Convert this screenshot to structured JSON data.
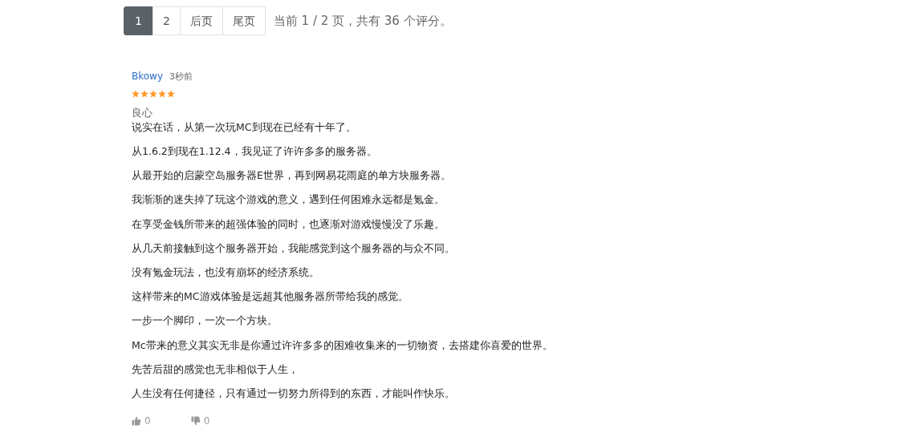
{
  "pagination": {
    "pages": [
      {
        "label": "1",
        "selected": true
      },
      {
        "label": "2",
        "selected": false
      },
      {
        "label": "后页",
        "selected": false
      },
      {
        "label": "尾页",
        "selected": false
      }
    ],
    "summary": "当前 1 / 2 页，共有 36 个评分。"
  },
  "review": {
    "author": "Bkowy",
    "time": "3秒前",
    "stars": 5,
    "title": "良心",
    "lines": [
      "说实在话，从第一次玩MC到现在已经有十年了。",
      "从1.6.2到现在1.12.4，我见证了许许多多的服务器。",
      "从最开始的启蒙空岛服务器E世界，再到网易花雨庭的单方块服务器。",
      "我渐渐的迷失掉了玩这个游戏的意义，遇到任何困难永远都是氪金。",
      "在享受金钱所带来的超强体验的同时，也逐渐对游戏慢慢没了乐趣。",
      "从几天前接触到这个服务器开始，我能感觉到这个服务器的与众不同。",
      "没有氪金玩法，也没有崩坏的经济系统。",
      "这样带来的MC游戏体验是远超其他服务器所带给我的感觉。",
      "一步一个脚印，一次一个方块。",
      "Mc带来的意义其实无非是你通过许许多多的困难收集来的一切物资，去搭建你喜爱的世界。",
      "先苦后甜的感觉也无非相似于人生，",
      "人生没有任何捷径，只有通过一切努力所得到的东西，才能叫作快乐。"
    ],
    "likes": "0",
    "dislikes": "0"
  }
}
